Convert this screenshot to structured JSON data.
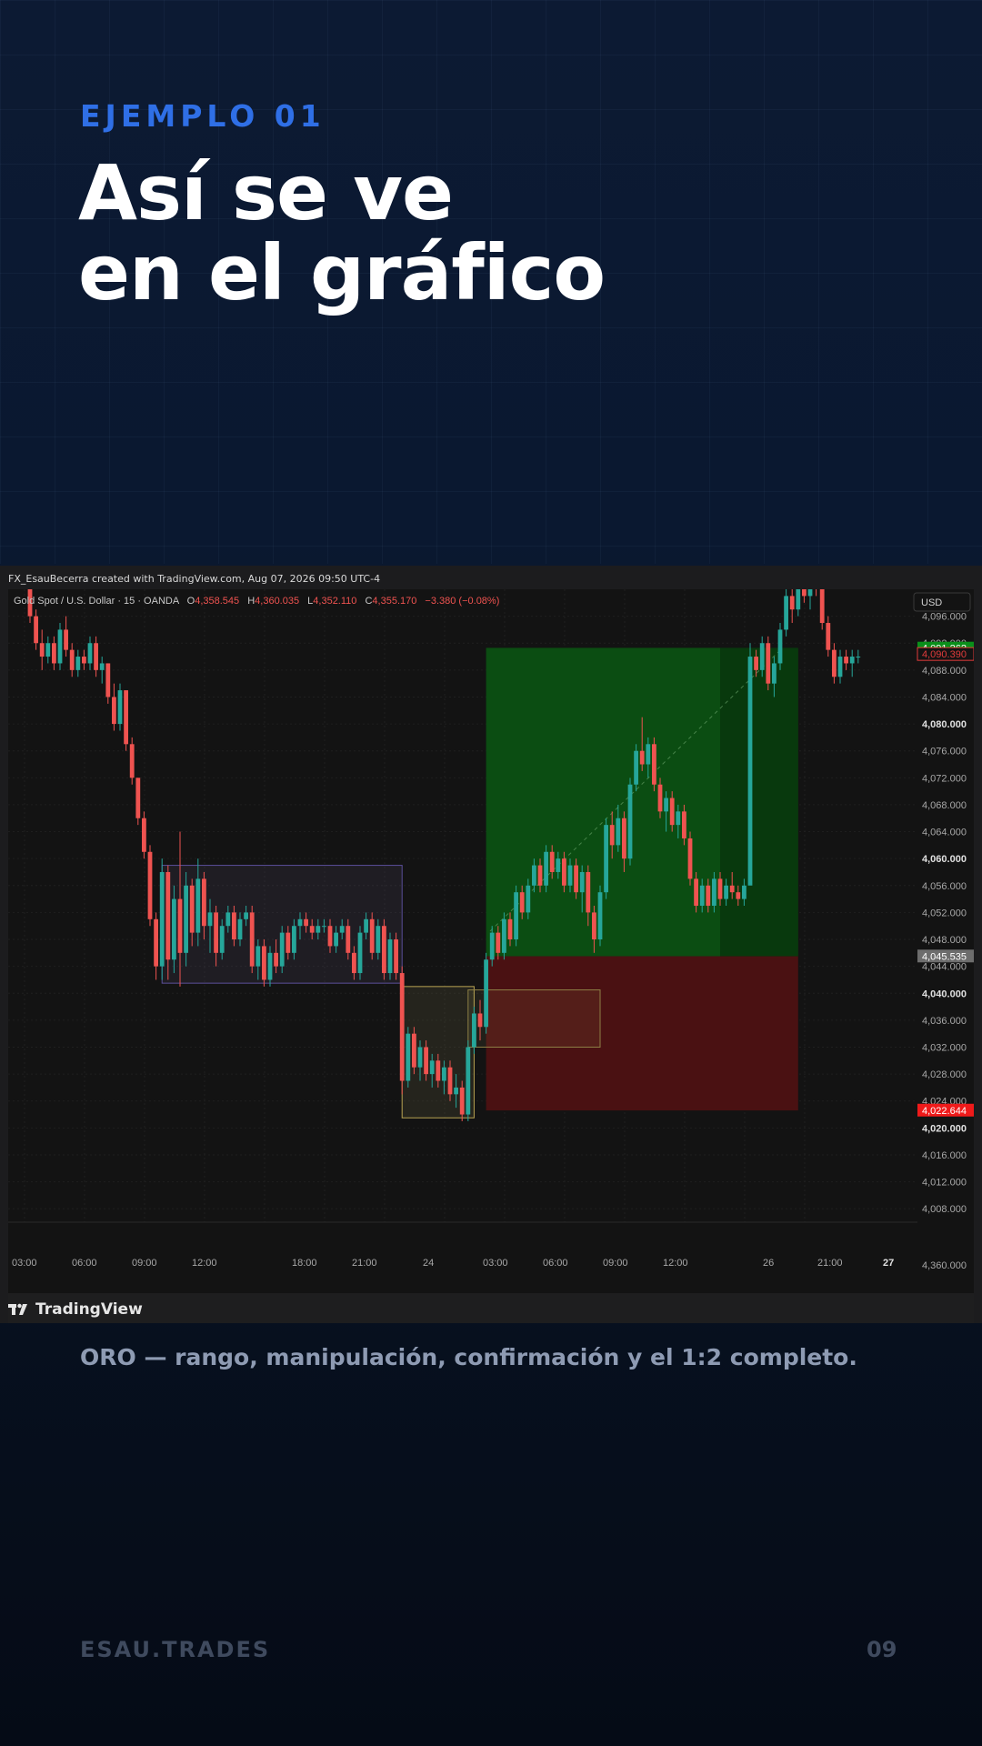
{
  "header": {
    "kicker": "EJEMPLO 01",
    "title_line1": "Así se ve",
    "title_line2": "en el gráfico"
  },
  "screenshot": {
    "credit": "FX_EsauBecerra created with TradingView.com, Aug 07, 2026 09:50 UTC-4",
    "footer_brand": "TradingView"
  },
  "chart_data": {
    "type": "candlestick",
    "symbol_line": {
      "name": "Gold Spot / U.S. Dollar · 15 · OANDA",
      "o_label": "O",
      "o_value": "4,358.545",
      "h_label": "H",
      "h_value": "4,360.035",
      "l_label": "L",
      "l_value": "4,352.110",
      "c_label": "C",
      "c_value": "4,355.170",
      "change": "−3.380 (−0.08%)"
    },
    "currency": "USD",
    "ylim": [
      4006,
      4100
    ],
    "y_ticks": [
      "4,096.000",
      "4,092.000",
      "4,088.000",
      "4,084.000",
      "4,080.000",
      "4,076.000",
      "4,072.000",
      "4,068.000",
      "4,064.000",
      "4,060.000",
      "4,056.000",
      "4,052.000",
      "4,048.000",
      "4,044.000",
      "4,040.000",
      "4,036.000",
      "4,032.000",
      "4,028.000",
      "4,024.000",
      "4,020.000",
      "4,016.000",
      "4,012.000",
      "4,008.000"
    ],
    "y_tick_values": [
      4096,
      4092,
      4088,
      4084,
      4080,
      4076,
      4072,
      4068,
      4064,
      4060,
      4056,
      4052,
      4048,
      4044,
      4040,
      4036,
      4032,
      4028,
      4024,
      4020,
      4016,
      4012,
      4008
    ],
    "bold_ticks": [
      "4,080.000",
      "4,060.000",
      "4,040.000",
      "4,020.000"
    ],
    "lower_pane_label": "4,360.000",
    "x_ticks": [
      "03:00",
      "06:00",
      "09:00",
      "12:00",
      "18:00",
      "21:00",
      "24",
      "03:00",
      "06:00",
      "09:00",
      "12:00",
      "26",
      "21:00",
      "27"
    ],
    "price_labels": [
      {
        "text": "4,091.262",
        "value": 4091.262,
        "style": "green"
      },
      {
        "text": "4,090.390",
        "value": 4090.39,
        "style": "red-outline"
      },
      {
        "text": "4,045.535",
        "value": 4045.535,
        "style": "gray"
      },
      {
        "text": "4,022.644",
        "value": 4022.644,
        "style": "red"
      }
    ],
    "zones": [
      {
        "kind": "range",
        "start": 22,
        "end": 62,
        "top": 4059,
        "bottom": 4041.5
      },
      {
        "kind": "manipulation",
        "start": 62,
        "end": 74,
        "top": 4041,
        "bottom": 4021.5
      },
      {
        "kind": "confirmation",
        "start": 73,
        "end": 95,
        "top": 4040.5,
        "bottom": 4032
      },
      {
        "kind": "target",
        "start": 76,
        "end": 128,
        "top": 4091.3,
        "bottom": 4045.5
      },
      {
        "kind": "stop",
        "start": 76,
        "end": 128,
        "top": 4045.5,
        "bottom": 4022.6
      }
    ],
    "candles_ohlc": [
      [
        4100,
        4102,
        4095,
        4096
      ],
      [
        4096,
        4097,
        4091,
        4092
      ],
      [
        4092,
        4094,
        4088,
        4090
      ],
      [
        4090,
        4093,
        4089,
        4092
      ],
      [
        4092,
        4093,
        4088,
        4089
      ],
      [
        4089,
        4095,
        4088,
        4094
      ],
      [
        4094,
        4096,
        4090,
        4091
      ],
      [
        4091,
        4092,
        4087,
        4088
      ],
      [
        4088,
        4091,
        4087,
        4090
      ],
      [
        4090,
        4091,
        4088,
        4089
      ],
      [
        4089,
        4093,
        4088,
        4092
      ],
      [
        4092,
        4093,
        4087,
        4088
      ],
      [
        4088,
        4090,
        4086,
        4089
      ],
      [
        4089,
        4089,
        4083,
        4084
      ],
      [
        4084,
        4086,
        4079,
        4080
      ],
      [
        4080,
        4086,
        4079,
        4085
      ],
      [
        4085,
        4085,
        4076,
        4077
      ],
      [
        4077,
        4078,
        4071,
        4072
      ],
      [
        4072,
        4072,
        4065,
        4066
      ],
      [
        4066,
        4067,
        4060,
        4061
      ],
      [
        4061,
        4062,
        4050,
        4051
      ],
      [
        4051,
        4052,
        4042,
        4044
      ],
      [
        4044,
        4060,
        4042,
        4058
      ],
      [
        4058,
        4059,
        4042,
        4045
      ],
      [
        4045,
        4056,
        4043,
        4054
      ],
      [
        4054,
        4064,
        4041,
        4046
      ],
      [
        4046,
        4058,
        4044,
        4056
      ],
      [
        4056,
        4057,
        4047,
        4049
      ],
      [
        4049,
        4060,
        4047,
        4057
      ],
      [
        4057,
        4058,
        4048,
        4050
      ],
      [
        4050,
        4054,
        4046,
        4052
      ],
      [
        4052,
        4053,
        4044,
        4046
      ],
      [
        4046,
        4051,
        4045,
        4050
      ],
      [
        4050,
        4053,
        4049,
        4052
      ],
      [
        4052,
        4053,
        4047,
        4048
      ],
      [
        4048,
        4052,
        4047,
        4051
      ],
      [
        4051,
        4053,
        4050,
        4052
      ],
      [
        4052,
        4053,
        4043,
        4044
      ],
      [
        4044,
        4048,
        4042,
        4047
      ],
      [
        4047,
        4048,
        4041,
        4042
      ],
      [
        4042,
        4047,
        4041,
        4046
      ],
      [
        4046,
        4048,
        4043,
        4044
      ],
      [
        4044,
        4050,
        4043,
        4049
      ],
      [
        4049,
        4050,
        4045,
        4046
      ],
      [
        4046,
        4051,
        4045,
        4050
      ],
      [
        4050,
        4052,
        4048,
        4051
      ],
      [
        4051,
        4052,
        4049,
        4050
      ],
      [
        4050,
        4051,
        4048,
        4049
      ],
      [
        4049,
        4051,
        4048,
        4050
      ],
      [
        4050,
        4051,
        4049,
        4050
      ],
      [
        4050,
        4051,
        4046,
        4047
      ],
      [
        4047,
        4050,
        4046,
        4049
      ],
      [
        4049,
        4051,
        4048,
        4050
      ],
      [
        4050,
        4051,
        4045,
        4046
      ],
      [
        4046,
        4047,
        4042,
        4043
      ],
      [
        4043,
        4050,
        4042,
        4049
      ],
      [
        4049,
        4052,
        4048,
        4051
      ],
      [
        4051,
        4052,
        4045,
        4046
      ],
      [
        4046,
        4051,
        4045,
        4050
      ],
      [
        4050,
        4051,
        4042,
        4043
      ],
      [
        4043,
        4049,
        4042,
        4048
      ],
      [
        4048,
        4049,
        4042,
        4043
      ],
      [
        4043,
        4044,
        4025,
        4027
      ],
      [
        4027,
        4035,
        4026,
        4034
      ],
      [
        4034,
        4035,
        4028,
        4029
      ],
      [
        4029,
        4033,
        4027,
        4032
      ],
      [
        4032,
        4033,
        4027,
        4028
      ],
      [
        4028,
        4031,
        4026,
        4030
      ],
      [
        4030,
        4031,
        4026,
        4027
      ],
      [
        4027,
        4030,
        4025,
        4029
      ],
      [
        4029,
        4030,
        4024,
        4025
      ],
      [
        4025,
        4028,
        4023,
        4026
      ],
      [
        4026,
        4027,
        4021,
        4022
      ],
      [
        4022,
        4033,
        4021,
        4032
      ],
      [
        4032,
        4038,
        4031,
        4037
      ],
      [
        4037,
        4039,
        4033,
        4035
      ],
      [
        4035,
        4046,
        4034,
        4045
      ],
      [
        4045,
        4050,
        4044,
        4049
      ],
      [
        4049,
        4050,
        4045,
        4046
      ],
      [
        4046,
        4052,
        4045,
        4051
      ],
      [
        4051,
        4052,
        4047,
        4048
      ],
      [
        4048,
        4056,
        4047,
        4055
      ],
      [
        4055,
        4056,
        4051,
        4052
      ],
      [
        4052,
        4057,
        4051,
        4056
      ],
      [
        4056,
        4060,
        4055,
        4059
      ],
      [
        4059,
        4060,
        4055,
        4056
      ],
      [
        4056,
        4062,
        4055,
        4061
      ],
      [
        4061,
        4062,
        4057,
        4058
      ],
      [
        4058,
        4061,
        4057,
        4060
      ],
      [
        4060,
        4061,
        4055,
        4056
      ],
      [
        4056,
        4060,
        4055,
        4059
      ],
      [
        4059,
        4060,
        4054,
        4055
      ],
      [
        4055,
        4059,
        4052,
        4058
      ],
      [
        4058,
        4059,
        4050,
        4052
      ],
      [
        4052,
        4053,
        4046,
        4048
      ],
      [
        4048,
        4056,
        4047,
        4055
      ],
      [
        4055,
        4066,
        4054,
        4065
      ],
      [
        4065,
        4067,
        4060,
        4062
      ],
      [
        4062,
        4068,
        4061,
        4066
      ],
      [
        4066,
        4067,
        4058,
        4060
      ],
      [
        4060,
        4072,
        4059,
        4071
      ],
      [
        4071,
        4077,
        4070,
        4076
      ],
      [
        4076,
        4081,
        4073,
        4074
      ],
      [
        4074,
        4078,
        4072,
        4077
      ],
      [
        4077,
        4078,
        4070,
        4071
      ],
      [
        4071,
        4072,
        4066,
        4067
      ],
      [
        4067,
        4070,
        4064,
        4069
      ],
      [
        4069,
        4070,
        4064,
        4065
      ],
      [
        4065,
        4068,
        4063,
        4067
      ],
      [
        4067,
        4068,
        4062,
        4063
      ],
      [
        4063,
        4064,
        4056,
        4057
      ],
      [
        4057,
        4058,
        4052,
        4053
      ],
      [
        4053,
        4057,
        4052,
        4056
      ],
      [
        4056,
        4057,
        4052,
        4053
      ],
      [
        4053,
        4058,
        4052,
        4057
      ],
      [
        4057,
        4058,
        4053,
        4054
      ],
      [
        4054,
        4057,
        4053,
        4056
      ],
      [
        4056,
        4058,
        4054,
        4055
      ],
      [
        4055,
        4056,
        4053,
        4054
      ],
      [
        4054,
        4057,
        4053,
        4056
      ],
      [
        4056,
        4092,
        4086,
        4090
      ],
      [
        4090,
        4091,
        4087,
        4088
      ],
      [
        4088,
        4093,
        4087,
        4092
      ],
      [
        4092,
        4093,
        4085,
        4086
      ],
      [
        4086,
        4090,
        4084,
        4089
      ],
      [
        4089,
        4095,
        4088,
        4094
      ],
      [
        4094,
        4100,
        4093,
        4099
      ],
      [
        4099,
        4104,
        4095,
        4097
      ],
      [
        4097,
        4104,
        4096,
        4103
      ],
      [
        4103,
        4104,
        4098,
        4099
      ],
      [
        4099,
        4103,
        4097,
        4102
      ],
      [
        4102,
        4103,
        4099,
        4100
      ],
      [
        4100,
        4101,
        4094,
        4095
      ],
      [
        4095,
        4096,
        4090,
        4091
      ],
      [
        4091,
        4092,
        4086,
        4087
      ],
      [
        4087,
        4091,
        4086,
        4090
      ],
      [
        4090,
        4091,
        4088,
        4089
      ],
      [
        4089,
        4091,
        4087,
        4090
      ],
      [
        4090,
        4091,
        4089,
        4090
      ]
    ]
  },
  "caption": "ORO — rango, manipulación, confirmación y el 1:2 completo.",
  "footer": {
    "brand": "ESAU.TRADES",
    "page": "09"
  },
  "colors": {
    "bull": "#26a69a",
    "bear": "#ef5350",
    "target_zone": "#0b4d12",
    "stop_zone": "#4a1112",
    "kicker": "#2f6fe6"
  }
}
